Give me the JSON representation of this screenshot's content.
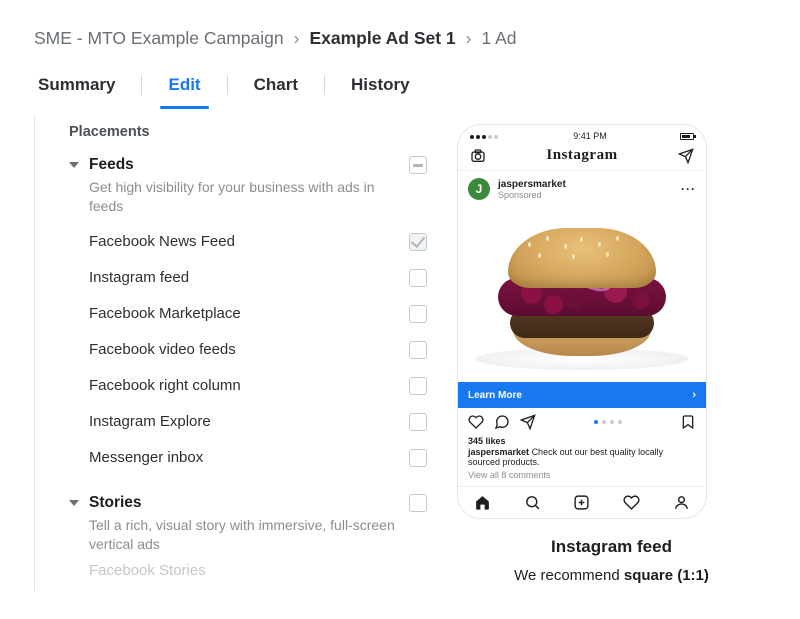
{
  "breadcrumb": {
    "campaign": "SME - MTO Example Campaign",
    "adset": "Example Ad Set 1",
    "ads": "1 Ad"
  },
  "tabs": {
    "summary": "Summary",
    "edit": "Edit",
    "chart": "Chart",
    "history": "History"
  },
  "placements": {
    "section_title": "Placements",
    "groups": [
      {
        "name": "Feeds",
        "desc": "Get high visibility for your business with ads in feeds",
        "state": "indeterminate",
        "items": [
          {
            "label": "Facebook News Feed",
            "checked": true
          },
          {
            "label": "Instagram feed",
            "checked": false
          },
          {
            "label": "Facebook Marketplace",
            "checked": false
          },
          {
            "label": "Facebook video feeds",
            "checked": false
          },
          {
            "label": "Facebook right column",
            "checked": false
          },
          {
            "label": "Instagram Explore",
            "checked": false
          },
          {
            "label": "Messenger inbox",
            "checked": false
          }
        ]
      },
      {
        "name": "Stories",
        "desc": "Tell a rich, visual story with immersive, full-screen vertical ads",
        "state": "unchecked",
        "items": [
          {
            "label": "Facebook Stories",
            "checked": false
          }
        ]
      }
    ]
  },
  "preview": {
    "status_time": "9:41 PM",
    "ig_brand": "Instagram",
    "account": "jaspersmarket",
    "sponsored": "Sponsored",
    "avatar_letter": "J",
    "cta": "Learn More",
    "likes": "345 likes",
    "caption_user": "jaspersmarket",
    "caption_text": "Check out our best quality locally sourced products.",
    "view_all": "View all 8 comments",
    "title": "Instagram feed",
    "reco_pre": "We recommend ",
    "reco_bold": "square (1:1)"
  }
}
